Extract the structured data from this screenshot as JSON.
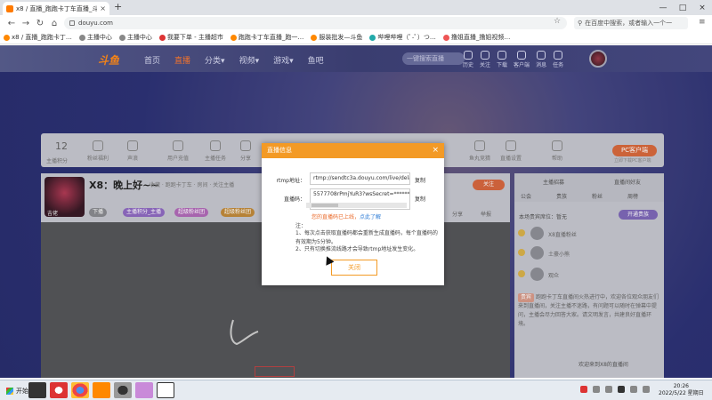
{
  "browser": {
    "tab_title": "x8 / 直播_跑跑卡丁车直播_斗鱼",
    "tab_close": "×",
    "new_tab": "+",
    "url": "douyu.com",
    "search_placeholder": "在百度中搜索，或者输入一个一",
    "window_controls": [
      "—",
      "□",
      "×"
    ],
    "bookmarks": [
      "x8 / 直播_跑跑卡丁…",
      "主播中心",
      "主播中心",
      "我要下单 - 主播超市",
      "跑跑卡丁车直播_跑一…",
      "服装批发—斗鱼",
      "哔哩哔哩（ﾟ-ﾟ）つ…",
      "撸姐直播_撸姐视频…"
    ]
  },
  "site": {
    "logo": "斗鱼",
    "nav": [
      "首页",
      "直播",
      "分类▾",
      "视频▾",
      "游戏▾",
      "鱼吧"
    ],
    "search_placeholder": "一键搜索直播",
    "header_icons": [
      "历史",
      "关注",
      "下载",
      "客户端",
      "消息",
      "任务"
    ],
    "gifts": [
      "主播积分",
      "粉丝福利",
      "声浪",
      "用户充值",
      "主播任务",
      "分享",
      "鱼丸竞猜",
      "",
      "直播设置",
      "",
      "",
      "",
      "超管",
      "VC商城",
      "帮助"
    ],
    "gift_count": "12",
    "pc_button": "PC客户端",
    "pc_sub": "立即下载PC客户端"
  },
  "player": {
    "title": "X8：晚上好~~",
    "level": "吉佬",
    "meta": "收藏 · 跑跑卡丁车 · 房间 · 关注主播",
    "badges": [
      "下播",
      "主播积分_主播",
      "超级粉丝团",
      "超级粉丝团"
    ],
    "follow": "关注",
    "share": "分享",
    "report": "举报"
  },
  "chat": {
    "tabs": [
      "主播招募",
      "直播间好友"
    ],
    "subtabs": [
      "公会",
      "贵族",
      "粉丝",
      "周榜"
    ],
    "note": "本场贵宾席位：暂无",
    "buy_btn": "开通贵族",
    "users": [
      "X8直播粉丝",
      "土豪小熊",
      "观众"
    ],
    "message_vip": "贵宾",
    "message": "跑跑卡丁车直播间火热进行中，欢迎各位观众朋友们来到直播间，关注主播不迷路，有问题可以随时在弹幕中提问，主播会尽力回答大家。请文明发言，共建良好直播环境。",
    "footer": "欢迎来到X8的直播间"
  },
  "modal": {
    "title": "直播信息",
    "close": "×",
    "rtmp_label": "rtmp地址：",
    "rtmp_value": "rtmp://sendtc3a.douyu.com/live/delay",
    "code_label": "直播码：",
    "code_value": "5577708rPmjYuR3?wsSecret=**********",
    "copy": "复制",
    "warning": "您的直播码已上线，",
    "warning_link": "点此了解",
    "note_title": "注：",
    "notes": [
      "1、每次点击获取直播码都会重新生成直播码，每个直播码的有效期为5分钟。",
      "2、只有切换推流线路才会导致rtmp地址发生变化。"
    ],
    "button": "关闭"
  },
  "taskbar": {
    "start": "开始",
    "time": "20:26",
    "date": "2022/5/22 星期日"
  }
}
